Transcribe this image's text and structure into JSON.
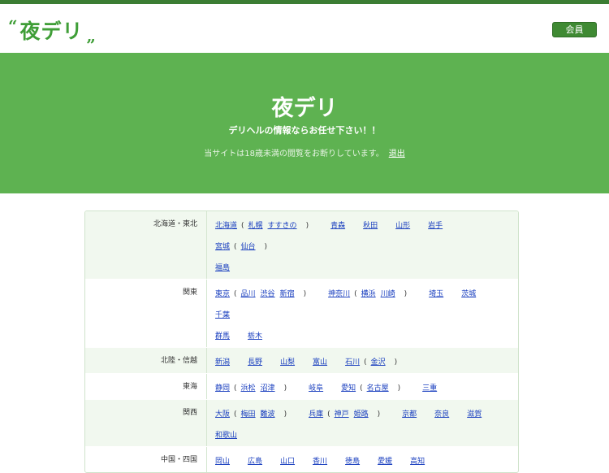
{
  "header": {
    "logo_quote_open": "“",
    "logo_text": "夜デリ",
    "logo_quote_close": "„",
    "member_button": "会員"
  },
  "hero": {
    "title": "夜デリ",
    "subtitle": "デリヘルの情報ならお任せ下さい！！",
    "notice": "当サイトは18歳未満の閲覧をお断りしています。",
    "exit_link": "退出"
  },
  "regions": [
    {
      "label": "北海道・東北",
      "lines": [
        [
          {
            "name": "北海道",
            "sub": [
              "札幌",
              "すすきの"
            ]
          },
          {
            "name": "青森"
          },
          {
            "name": "秋田"
          },
          {
            "name": "山形"
          },
          {
            "name": "岩手"
          },
          {
            "name": "宮城",
            "sub": [
              "仙台"
            ]
          }
        ],
        [
          {
            "name": "福島"
          }
        ]
      ]
    },
    {
      "label": "関東",
      "lines": [
        [
          {
            "name": "東京",
            "sub": [
              "品川",
              "渋谷",
              "新宿"
            ]
          },
          {
            "name": "神奈川",
            "sub": [
              "横浜",
              "川崎"
            ]
          },
          {
            "name": "埼玉"
          },
          {
            "name": "茨城"
          },
          {
            "name": "千葉"
          }
        ],
        [
          {
            "name": "群馬"
          },
          {
            "name": "栃木"
          }
        ]
      ]
    },
    {
      "label": "北陸・信越",
      "lines": [
        [
          {
            "name": "新潟"
          },
          {
            "name": "長野"
          },
          {
            "name": "山梨"
          },
          {
            "name": "富山"
          },
          {
            "name": "石川",
            "sub": [
              "金沢"
            ]
          }
        ]
      ]
    },
    {
      "label": "東海",
      "lines": [
        [
          {
            "name": "静岡",
            "sub": [
              "浜松",
              "沼津"
            ]
          },
          {
            "name": "岐阜"
          },
          {
            "name": "愛知",
            "sub": [
              "名古屋"
            ]
          },
          {
            "name": "三重"
          }
        ]
      ]
    },
    {
      "label": "関西",
      "lines": [
        [
          {
            "name": "大阪",
            "sub": [
              "梅田",
              "難波"
            ]
          },
          {
            "name": "兵庫",
            "sub": [
              "神戸",
              "姫路"
            ]
          },
          {
            "name": "京都"
          },
          {
            "name": "奈良"
          },
          {
            "name": "滋賀"
          },
          {
            "name": "和歌山"
          }
        ]
      ]
    },
    {
      "label": "中国・四国",
      "lines": [
        [
          {
            "name": "岡山"
          },
          {
            "name": "広島"
          },
          {
            "name": "山口"
          },
          {
            "name": "香川"
          },
          {
            "name": "徳島"
          },
          {
            "name": "愛媛"
          },
          {
            "name": "高知"
          }
        ]
      ]
    }
  ],
  "colors": {
    "hero_bg": "#5eb251",
    "brand_green": "#3f9e37",
    "link": "#1a3fbf"
  }
}
